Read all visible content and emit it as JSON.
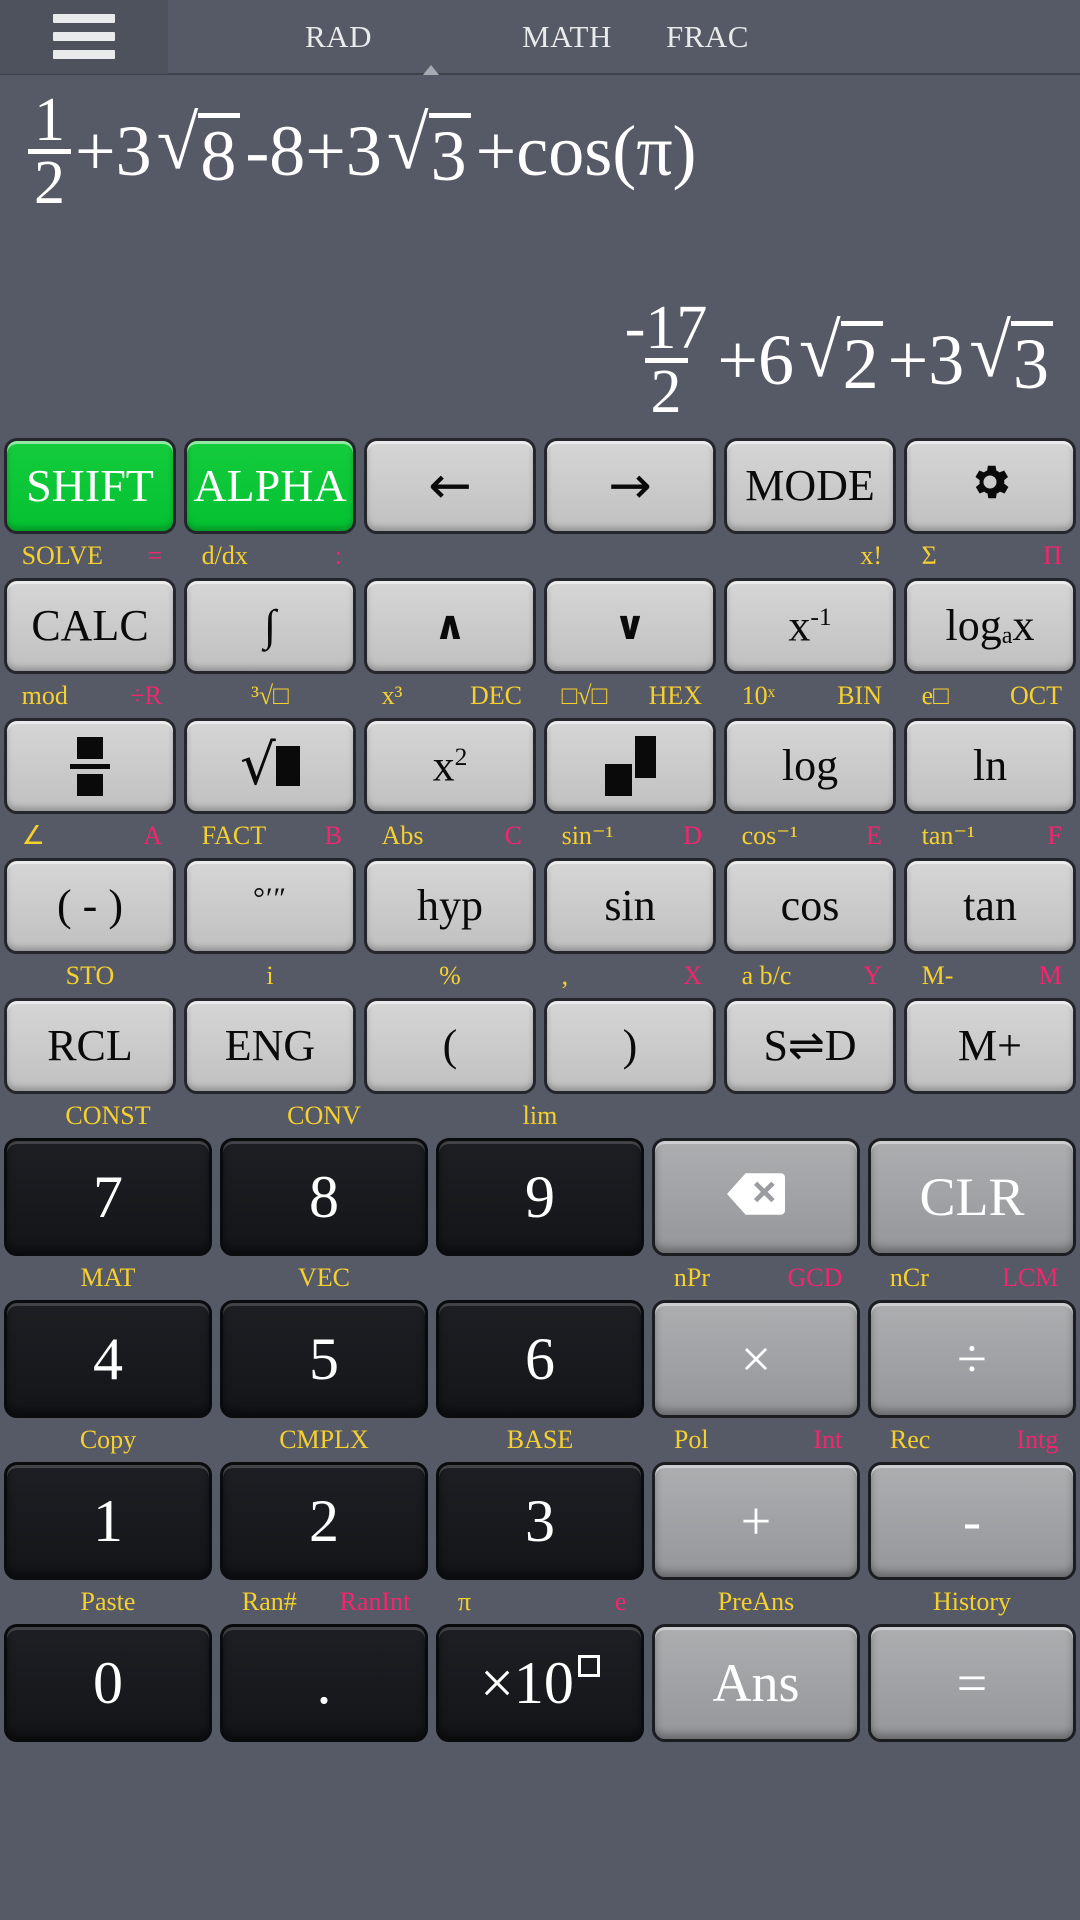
{
  "topbar": {
    "menu_icon": "hamburger-menu-icon",
    "status": {
      "angle_mode": "RAD",
      "indicator_icon": "triangle-up-icon",
      "input_mode": "MATH",
      "output_mode": "FRAC"
    }
  },
  "display": {
    "expression": {
      "text": "1/2+3√8 -8+3√3 +cos(π)",
      "parts": {
        "frac_num": "1",
        "frac_den": "2",
        "t1": "+3",
        "r1": "8",
        "t2": "-8+3",
        "r2": "3",
        "t3": "+cos(π)"
      }
    },
    "result": {
      "text": "-17/2+6√2 +3√3",
      "parts": {
        "frac_num": "-17",
        "frac_den": "2",
        "t1": "+6",
        "r1": "2",
        "t2": "+3",
        "r2": "3"
      }
    }
  },
  "colors": {
    "background": "#565a66",
    "shift_green": "#04c132",
    "hint_yellow": "#f6d02f",
    "hint_pink": "#f4256f",
    "fn_key": "#c8c8c8",
    "num_key": "#16181c",
    "op_key": "#9a9c9f"
  },
  "keypad": {
    "rows": [
      {
        "hints": [],
        "keys": [
          {
            "label": "SHIFT",
            "style": "green",
            "name": "shift"
          },
          {
            "label": "ALPHA",
            "style": "green",
            "name": "alpha"
          },
          {
            "label": "←",
            "style": "fn",
            "name": "arrow-left",
            "icon": "arrow-left-icon"
          },
          {
            "label": "→",
            "style": "fn",
            "name": "arrow-right",
            "icon": "arrow-right-icon"
          },
          {
            "label": "MODE",
            "style": "fn",
            "name": "mode"
          },
          {
            "label": "",
            "style": "fn",
            "name": "settings",
            "icon": "gear-icon"
          }
        ]
      },
      {
        "hints": [
          {
            "left": "SOLVE",
            "left_color": "y",
            "right": "=",
            "right_color": "p"
          },
          {
            "left": "d/dx",
            "left_color": "y",
            "right": ":",
            "right_color": "p"
          },
          {},
          {},
          {
            "right": "x!",
            "right_color": "y"
          },
          {
            "left": "Σ",
            "left_color": "y",
            "right": "Π",
            "right_color": "p"
          }
        ],
        "keys": [
          {
            "label": "CALC",
            "style": "fn",
            "name": "calc"
          },
          {
            "label": "∫",
            "style": "fn",
            "name": "integral"
          },
          {
            "label": "∧",
            "style": "fn",
            "name": "arrow-up",
            "icon": "chevron-up-icon"
          },
          {
            "label": "∨",
            "style": "fn",
            "name": "arrow-down",
            "icon": "chevron-down-icon"
          },
          {
            "label": "x⁻¹",
            "style": "fn",
            "name": "reciprocal"
          },
          {
            "label": "logₐx",
            "style": "fn",
            "name": "log-base-a"
          }
        ]
      },
      {
        "hints": [
          {
            "left": "mod",
            "left_color": "y",
            "right": "÷R",
            "right_color": "p"
          },
          {
            "center": "³√□",
            "center_color": "y"
          },
          {
            "left": "x³",
            "left_color": "y",
            "right": "DEC",
            "right_color": "y"
          },
          {
            "left": "□√□",
            "left_color": "y",
            "right": "HEX",
            "right_color": "y"
          },
          {
            "left": "10ˣ",
            "left_color": "y",
            "right": "BIN",
            "right_color": "y"
          },
          {
            "left": "e□",
            "left_color": "y",
            "right": "OCT",
            "right_color": "y"
          }
        ],
        "keys": [
          {
            "label": "",
            "style": "fn",
            "name": "fraction",
            "icon": "fraction-icon"
          },
          {
            "label": "",
            "style": "fn",
            "name": "square-root",
            "icon": "sqrt-icon"
          },
          {
            "label": "x²",
            "style": "fn",
            "name": "square"
          },
          {
            "label": "",
            "style": "fn",
            "name": "power",
            "icon": "power-icon"
          },
          {
            "label": "log",
            "style": "fn",
            "name": "log"
          },
          {
            "label": "ln",
            "style": "fn",
            "name": "ln"
          }
        ]
      },
      {
        "hints": [
          {
            "left": "∠",
            "left_color": "y",
            "right": "A",
            "right_color": "p"
          },
          {
            "left": "FACT",
            "left_color": "y",
            "right": "B",
            "right_color": "p"
          },
          {
            "left": "Abs",
            "left_color": "y",
            "right": "C",
            "right_color": "p"
          },
          {
            "left": "sin⁻¹",
            "left_color": "y",
            "right": "D",
            "right_color": "p"
          },
          {
            "left": "cos⁻¹",
            "left_color": "y",
            "right": "E",
            "right_color": "p"
          },
          {
            "left": "tan⁻¹",
            "left_color": "y",
            "right": "F",
            "right_color": "p"
          }
        ],
        "keys": [
          {
            "label": "( - )",
            "style": "fn",
            "name": "negative"
          },
          {
            "label": "°‴",
            "style": "fn",
            "name": "degrees-minutes-seconds"
          },
          {
            "label": "hyp",
            "style": "fn",
            "name": "hyp"
          },
          {
            "label": "sin",
            "style": "fn",
            "name": "sin"
          },
          {
            "label": "cos",
            "style": "fn",
            "name": "cos"
          },
          {
            "label": "tan",
            "style": "fn",
            "name": "tan"
          }
        ]
      },
      {
        "hints": [
          {
            "center": "STO",
            "center_color": "y"
          },
          {
            "center": "i",
            "center_color": "y"
          },
          {
            "center": "%",
            "center_color": "y"
          },
          {
            "left": ",",
            "left_color": "y",
            "right": "X",
            "right_color": "p"
          },
          {
            "left": "a b/c",
            "left_color": "y",
            "right": "Y",
            "right_color": "p"
          },
          {
            "left": "M-",
            "left_color": "y",
            "right": "M",
            "right_color": "p"
          }
        ],
        "keys": [
          {
            "label": "RCL",
            "style": "fn",
            "name": "rcl"
          },
          {
            "label": "ENG",
            "style": "fn",
            "name": "eng"
          },
          {
            "label": "(",
            "style": "fn",
            "name": "paren-open"
          },
          {
            "label": ")",
            "style": "fn",
            "name": "paren-close"
          },
          {
            "label": "S⇌D",
            "style": "fn",
            "name": "s-to-d"
          },
          {
            "label": "M+",
            "style": "fn",
            "name": "memory-plus"
          }
        ]
      }
    ],
    "numrows": [
      {
        "hints": [
          {
            "center": "CONST",
            "center_color": "y"
          },
          {
            "center": "CONV",
            "center_color": "y"
          },
          {
            "center": "lim",
            "center_color": "y"
          },
          {},
          {}
        ],
        "keys": [
          {
            "label": "7",
            "style": "num",
            "name": "digit-7"
          },
          {
            "label": "8",
            "style": "num",
            "name": "digit-8"
          },
          {
            "label": "9",
            "style": "num",
            "name": "digit-9"
          },
          {
            "label": "",
            "style": "opr",
            "name": "backspace",
            "icon": "backspace-icon"
          },
          {
            "label": "CLR",
            "style": "opr",
            "name": "clear"
          }
        ]
      },
      {
        "hints": [
          {
            "center": "MAT",
            "center_color": "y"
          },
          {
            "center": "VEC",
            "center_color": "y"
          },
          {},
          {
            "left": "nPr",
            "left_color": "y",
            "right": "GCD",
            "right_color": "p"
          },
          {
            "left": "nCr",
            "left_color": "y",
            "right": "LCM",
            "right_color": "p"
          }
        ],
        "keys": [
          {
            "label": "4",
            "style": "num",
            "name": "digit-4"
          },
          {
            "label": "5",
            "style": "num",
            "name": "digit-5"
          },
          {
            "label": "6",
            "style": "num",
            "name": "digit-6"
          },
          {
            "label": "×",
            "style": "opr",
            "name": "multiply"
          },
          {
            "label": "÷",
            "style": "opr",
            "name": "divide"
          }
        ]
      },
      {
        "hints": [
          {
            "center": "Copy",
            "center_color": "y"
          },
          {
            "center": "CMPLX",
            "center_color": "y"
          },
          {
            "center": "BASE",
            "center_color": "y"
          },
          {
            "left": "Pol",
            "left_color": "y",
            "right": "Int",
            "right_color": "p"
          },
          {
            "left": "Rec",
            "left_color": "y",
            "right": "Intg",
            "right_color": "p"
          }
        ],
        "keys": [
          {
            "label": "1",
            "style": "num",
            "name": "digit-1"
          },
          {
            "label": "2",
            "style": "num",
            "name": "digit-2"
          },
          {
            "label": "3",
            "style": "num",
            "name": "digit-3"
          },
          {
            "label": "+",
            "style": "opr",
            "name": "plus"
          },
          {
            "label": "-",
            "style": "opr",
            "name": "minus"
          }
        ]
      },
      {
        "hints": [
          {
            "center": "Paste",
            "center_color": "y"
          },
          {
            "left": "Ran#",
            "left_color": "y",
            "right": "RanInt",
            "right_color": "p"
          },
          {
            "left": "π",
            "left_color": "y",
            "right": "e",
            "right_color": "p"
          },
          {
            "center": "PreAns",
            "center_color": "y"
          },
          {
            "center": "History",
            "center_color": "y"
          }
        ],
        "keys": [
          {
            "label": "0",
            "style": "num",
            "name": "digit-0"
          },
          {
            "label": ".",
            "style": "num",
            "name": "decimal-point"
          },
          {
            "label": "×10",
            "style": "num",
            "name": "exponent",
            "icon": "x10-icon"
          },
          {
            "label": "Ans",
            "style": "opr",
            "name": "ans"
          },
          {
            "label": "=",
            "style": "opr",
            "name": "equals"
          }
        ]
      }
    ]
  }
}
